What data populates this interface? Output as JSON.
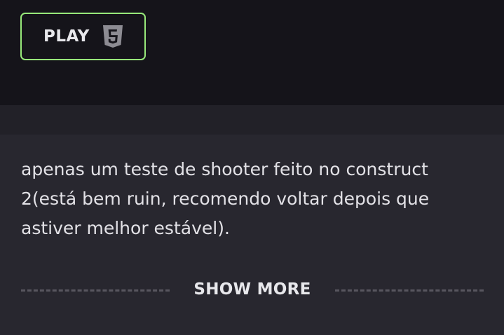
{
  "header": {
    "play_label": "PLAY",
    "play_icon": "html5-icon",
    "accent_color": "#97e97a"
  },
  "description": {
    "text": "apenas um teste de shooter feito no construct 2(está bem ruin, recomendo voltar depois que astiver melhor estável)."
  },
  "footer": {
    "show_more_label": "SHOW MORE"
  }
}
